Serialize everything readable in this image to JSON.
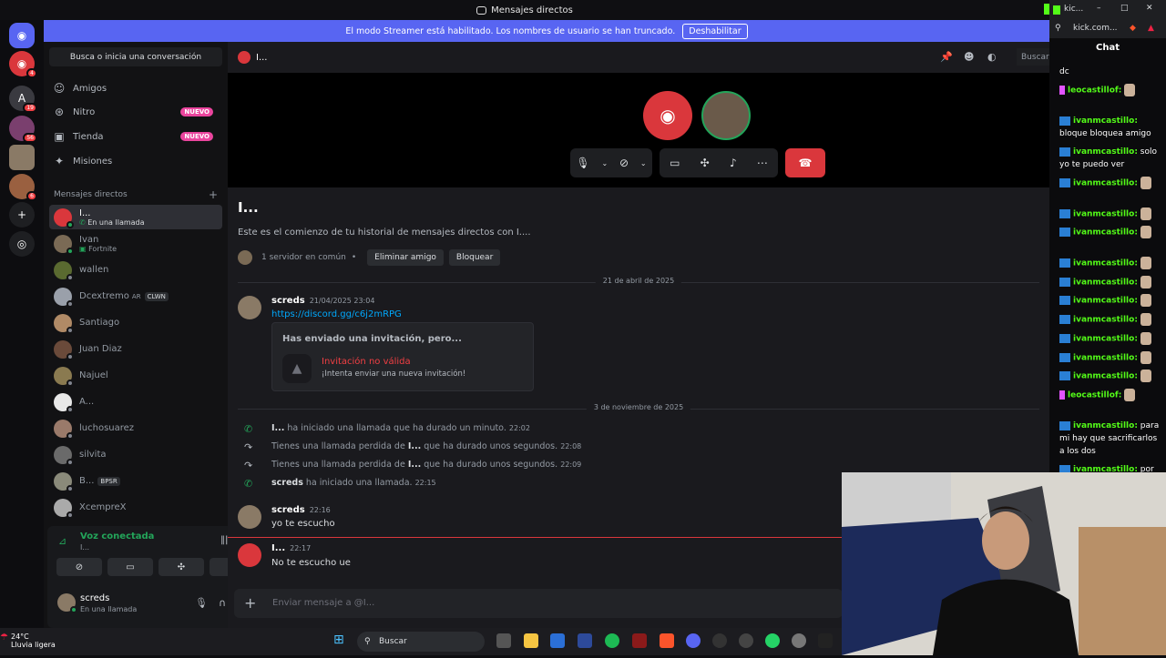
{
  "window": {
    "title": "Mensajes directos"
  },
  "streamer_banner": {
    "text": "El modo Streamer está habilitado. Los nombres de usuario se han truncado.",
    "button": "Deshabilitar"
  },
  "servers": {
    "badges": [
      "4",
      "19",
      "56",
      "6"
    ]
  },
  "dm_sidebar": {
    "search": "Busca o inicia una conversación",
    "nav": [
      {
        "label": "Amigos",
        "icon": "friends-icon"
      },
      {
        "label": "Nitro",
        "icon": "nitro-icon",
        "badge": "NUEVO"
      },
      {
        "label": "Tienda",
        "icon": "shop-icon",
        "badge": "NUEVO"
      },
      {
        "label": "Misiones",
        "icon": "quests-icon"
      }
    ],
    "section_title": "Mensajes directos",
    "users": [
      {
        "name": "I...",
        "sub": "En una llamada"
      },
      {
        "name": "Ivan",
        "sub": "Fortnite"
      },
      {
        "name": "wallen",
        "sub": ""
      },
      {
        "name": "Dcextremo",
        "tag1": "AR",
        "tag2": "CLWN"
      },
      {
        "name": "Santiago",
        "sub": ""
      },
      {
        "name": "Juan Diaz",
        "sub": ""
      },
      {
        "name": "Najuel",
        "sub": ""
      },
      {
        "name": "A...",
        "sub": ""
      },
      {
        "name": "luchosuarez",
        "sub": ""
      },
      {
        "name": "silvita",
        "sub": ""
      },
      {
        "name": "B...",
        "tag2": "BPSR"
      },
      {
        "name": "XcempreX",
        "sub": ""
      }
    ]
  },
  "voice": {
    "title": "Voz conectada",
    "sub": "I..."
  },
  "me": {
    "name": "screds",
    "status": "En una llamada"
  },
  "channel": {
    "name": "I...",
    "search": "Buscar"
  },
  "intro": {
    "title": "I...",
    "text": "Este es el comienzo de tu historial de mensajes directos con I....",
    "mutual": "1 servidor en común",
    "remove": "Eliminar amigo",
    "block": "Bloquear"
  },
  "messages": {
    "date1": "21 de abril de 2025",
    "m1": {
      "author": "screds",
      "time": "21/04/2025 23:04",
      "link": "https://discord.gg/c6j2mRPG"
    },
    "invite": {
      "title": "Has enviado una invitación, pero...",
      "result": "Invitación no válida",
      "sub": "¡Intenta enviar una nueva invitación!"
    },
    "date2": "3 de noviembre de 2025",
    "sys": [
      {
        "who": "I...",
        "text": "ha iniciado una llamada que ha durado un minuto.",
        "time": "22:02"
      },
      {
        "pre": "Tienes una llamada perdida de",
        "who": "I...",
        "text": "que ha durado unos segundos.",
        "time": "22:08"
      },
      {
        "pre": "Tienes una llamada perdida de",
        "who": "I...",
        "text": "que ha durado unos segundos.",
        "time": "22:09"
      },
      {
        "who": "screds",
        "text": "ha iniciado una llamada.",
        "time": "22:15"
      }
    ],
    "m2": {
      "author": "screds",
      "time": "22:16",
      "text": "yo te escucho"
    },
    "m3": {
      "author": "I...",
      "time": "22:17",
      "text": "No te escucho ue"
    }
  },
  "composer": {
    "placeholder": "Enviar mensaje a @I..."
  },
  "kick": {
    "tab": "kic...",
    "url": "kick.com...",
    "chat_title": "Chat",
    "lines": [
      {
        "user": "",
        "text": "dc"
      },
      {
        "user": "leocastillof:",
        "text": ""
      },
      {
        "user": "ivanmcastillo:",
        "text": "bloque bloquea amigo"
      },
      {
        "user": "ivanmcastillo:",
        "text": "solo yo te puedo ver"
      },
      {
        "user": "ivanmcastillo:",
        "text": ""
      },
      {
        "user": "ivanmcastillo:",
        "text": ""
      },
      {
        "user": "ivanmcastillo:",
        "text": ""
      },
      {
        "user": "ivanmcastillo:",
        "text": ""
      },
      {
        "user": "ivanmcastillo:",
        "text": ""
      },
      {
        "user": "ivanmcastillo:",
        "text": ""
      },
      {
        "user": "ivanmcastillo:",
        "text": ""
      },
      {
        "user": "ivanmcastillo:",
        "text": ""
      },
      {
        "user": "ivanmcastillo:",
        "text": ""
      },
      {
        "user": "ivanmcastillo:",
        "text": ""
      },
      {
        "user": "leocastillof:",
        "text": ""
      },
      {
        "user": "ivanmcastillo:",
        "text": "para mi hay que sacrificarlos a los dos"
      },
      {
        "user": "ivanmcastillo:",
        "text": "por dc"
      }
    ]
  },
  "taskbar": {
    "temp": "24°C",
    "weather": "Lluvia ligera",
    "search": "Buscar"
  },
  "colors": {
    "blurple": "#5865f2",
    "red": "#da373c",
    "green": "#23a55a",
    "kick_green": "#53fc18"
  }
}
